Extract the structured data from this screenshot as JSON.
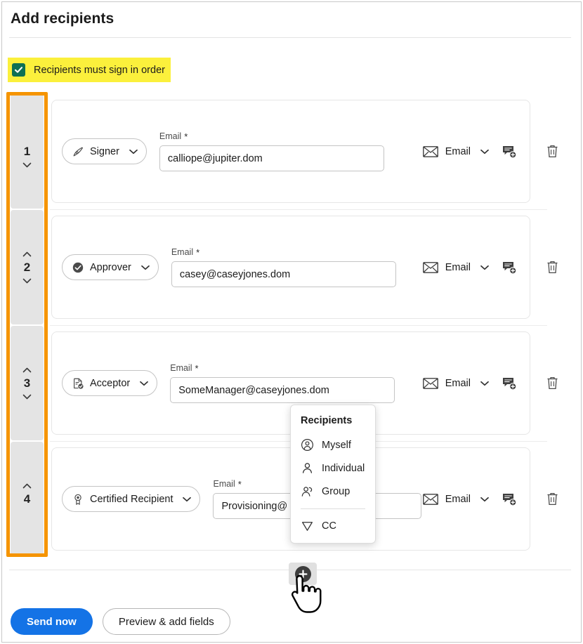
{
  "page": {
    "title": "Add recipients"
  },
  "sign_order": {
    "label": "Recipients must sign in order",
    "checked": true,
    "highlight_color": "#fbf03c",
    "checkbox_color": "#0d7054"
  },
  "annotation": {
    "color": "#f59400",
    "target": "order-rail"
  },
  "labels": {
    "email_label": "Email",
    "required_marker": "*"
  },
  "recipients": [
    {
      "order": "1",
      "role": "Signer",
      "role_icon": "pen-nib-icon",
      "email": "calliope@jupiter.dom",
      "email_placeholder": "Email",
      "delivery": "Email",
      "can_move_up": false,
      "can_move_down": true
    },
    {
      "order": "2",
      "role": "Approver",
      "role_icon": "check-circle-icon",
      "email": "casey@caseyjones.dom",
      "email_placeholder": "Email",
      "delivery": "Email",
      "can_move_up": true,
      "can_move_down": true
    },
    {
      "order": "3",
      "role": "Acceptor",
      "role_icon": "document-check-icon",
      "email": "SomeManager@caseyjones.dom",
      "email_placeholder": "Email",
      "delivery": "Email",
      "can_move_up": true,
      "can_move_down": true
    },
    {
      "order": "4",
      "role": "Certified Recipient",
      "role_icon": "award-ribbon-icon",
      "email": "Provisioning@",
      "email_placeholder": "Email",
      "delivery": "Email",
      "can_move_up": true,
      "can_move_down": false
    }
  ],
  "row_icons": {
    "envelope_icon": "envelope-icon",
    "delivery_chevron_icon": "chevron-down-icon",
    "add_note_icon": "add-private-message-icon",
    "delete_icon": "trash-icon"
  },
  "popup": {
    "title": "Recipients",
    "items": [
      {
        "label": "Myself",
        "icon": "user-circle-icon"
      },
      {
        "label": "Individual",
        "icon": "user-icon"
      },
      {
        "label": "Group",
        "icon": "users-group-icon"
      }
    ],
    "separated_items": [
      {
        "label": "CC",
        "icon": "send-paper-plane-icon"
      }
    ]
  },
  "add_button": {
    "icon": "plus-circle-icon",
    "hovered": true
  },
  "footer": {
    "primary_label": "Send now",
    "secondary_label": "Preview & add fields",
    "primary_color": "#1473e6"
  }
}
